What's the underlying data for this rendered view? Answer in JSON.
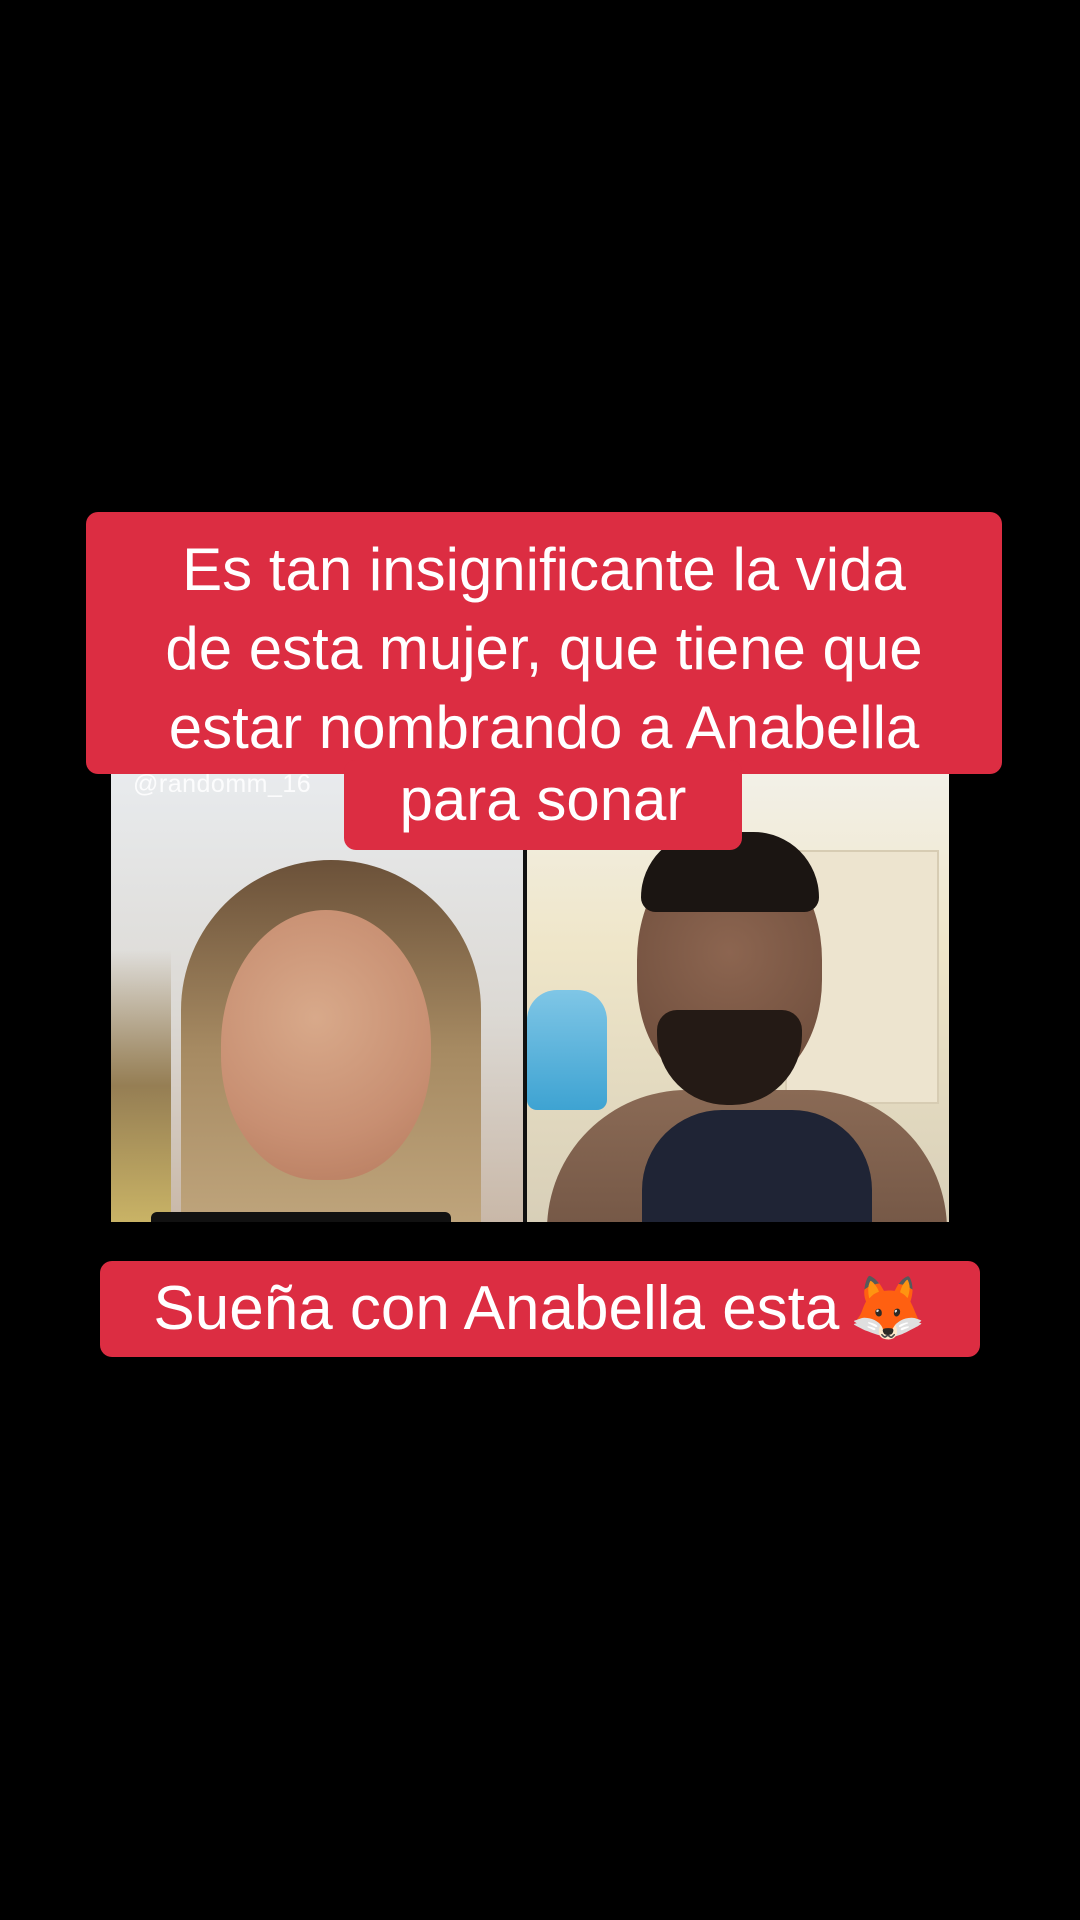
{
  "overlay_caption": {
    "lines": [
      "Es tan insignificante la vida",
      "de esta mujer, que tiene que",
      "estar nombrando a Anabella",
      "para sonar"
    ],
    "background": "#dc2d42",
    "text_color": "#ffffff"
  },
  "video": {
    "watermark_username": "@randomm_16"
  },
  "bottom_caption": {
    "text": "Sueña con Anabella esta",
    "emoji": "🦊",
    "background": "#dc2d42",
    "text_color": "#ffffff"
  },
  "page": {
    "background": "#000000"
  }
}
